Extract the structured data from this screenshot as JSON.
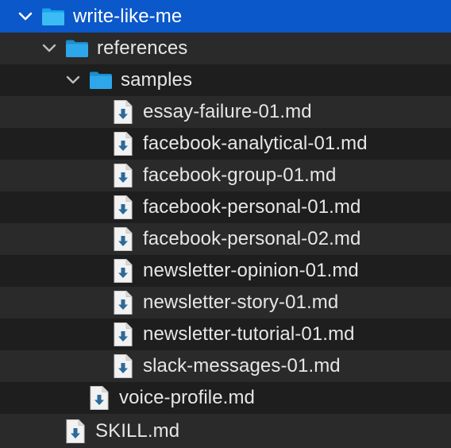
{
  "tree": {
    "root": {
      "label": "write-like-me",
      "icon": "folder-icon",
      "expanded": true,
      "selected": true
    },
    "references": {
      "label": "references",
      "icon": "folder-icon",
      "expanded": true
    },
    "samples": {
      "label": "samples",
      "icon": "folder-icon",
      "expanded": true,
      "files": [
        "essay-failure-01.md",
        "facebook-analytical-01.md",
        "facebook-group-01.md",
        "facebook-personal-01.md",
        "facebook-personal-02.md",
        "newsletter-opinion-01.md",
        "newsletter-story-01.md",
        "newsletter-tutorial-01.md",
        "slack-messages-01.md"
      ]
    },
    "voice_profile": {
      "label": "voice-profile.md",
      "icon": "markdown-file-icon"
    },
    "skill": {
      "label": "SKILL.md",
      "icon": "markdown-file-icon"
    }
  },
  "colors": {
    "selection": "#0a58ca",
    "folder": "#1aa3e8",
    "background": "#1e1e1e",
    "row_alt": "#2a2a2a",
    "text": "#e6e6e6",
    "file_arrow": "#2b6a9a"
  }
}
